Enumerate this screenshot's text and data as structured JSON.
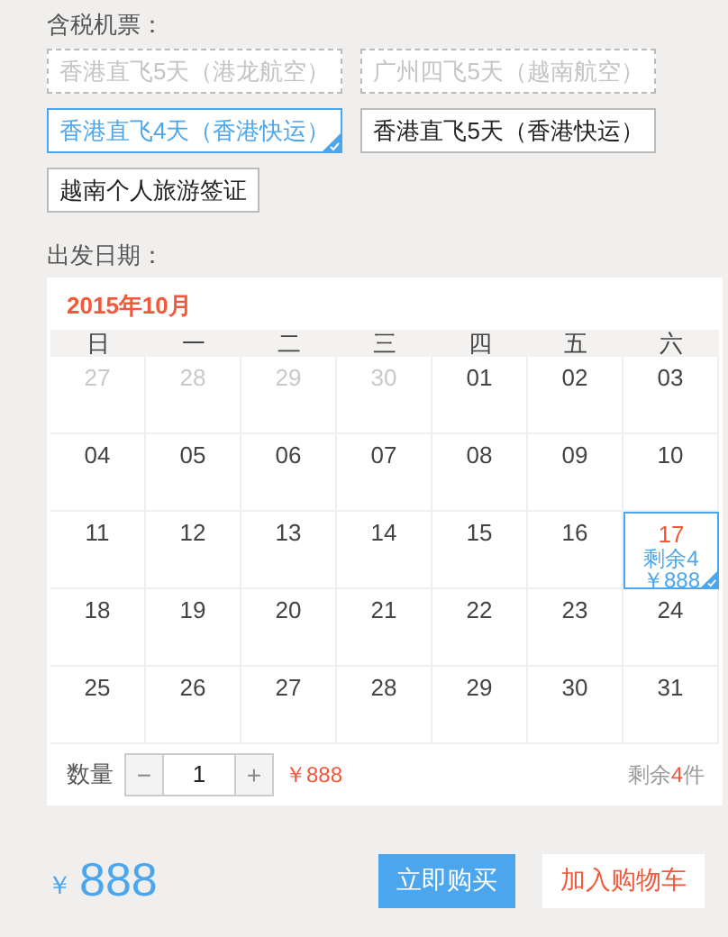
{
  "ticket_label": "含税机票：",
  "options": [
    {
      "label": "香港直飞5天（港龙航空）",
      "disabled": true,
      "selected": false
    },
    {
      "label": "广州四飞5天（越南航空）",
      "disabled": true,
      "selected": false
    },
    {
      "label": "香港直飞4天（香港快运）",
      "disabled": false,
      "selected": true
    },
    {
      "label": "香港直飞5天（香港快运）",
      "disabled": false,
      "selected": false
    },
    {
      "label": "越南个人旅游签证",
      "disabled": false,
      "selected": false
    }
  ],
  "date_label": "出发日期：",
  "calendar": {
    "month": "2015年10月",
    "weekdays": [
      "日",
      "一",
      "二",
      "三",
      "四",
      "五",
      "六"
    ],
    "days": [
      {
        "day": "27",
        "muted": true,
        "selected": false
      },
      {
        "day": "28",
        "muted": true,
        "selected": false
      },
      {
        "day": "29",
        "muted": true,
        "selected": false
      },
      {
        "day": "30",
        "muted": true,
        "selected": false
      },
      {
        "day": "01",
        "muted": false,
        "selected": false
      },
      {
        "day": "02",
        "muted": false,
        "selected": false
      },
      {
        "day": "03",
        "muted": false,
        "selected": false
      },
      {
        "day": "04",
        "muted": false,
        "selected": false
      },
      {
        "day": "05",
        "muted": false,
        "selected": false
      },
      {
        "day": "06",
        "muted": false,
        "selected": false
      },
      {
        "day": "07",
        "muted": false,
        "selected": false
      },
      {
        "day": "08",
        "muted": false,
        "selected": false
      },
      {
        "day": "09",
        "muted": false,
        "selected": false
      },
      {
        "day": "10",
        "muted": false,
        "selected": false
      },
      {
        "day": "11",
        "muted": false,
        "selected": false
      },
      {
        "day": "12",
        "muted": false,
        "selected": false
      },
      {
        "day": "13",
        "muted": false,
        "selected": false
      },
      {
        "day": "14",
        "muted": false,
        "selected": false
      },
      {
        "day": "15",
        "muted": false,
        "selected": false
      },
      {
        "day": "16",
        "muted": false,
        "selected": false
      },
      {
        "day": "17",
        "muted": false,
        "selected": true,
        "stock": "剩余4",
        "price": "￥888"
      },
      {
        "day": "18",
        "muted": false,
        "selected": false
      },
      {
        "day": "19",
        "muted": false,
        "selected": false
      },
      {
        "day": "20",
        "muted": false,
        "selected": false
      },
      {
        "day": "21",
        "muted": false,
        "selected": false
      },
      {
        "day": "22",
        "muted": false,
        "selected": false
      },
      {
        "day": "23",
        "muted": false,
        "selected": false
      },
      {
        "day": "24",
        "muted": false,
        "selected": false
      },
      {
        "day": "25",
        "muted": false,
        "selected": false
      },
      {
        "day": "26",
        "muted": false,
        "selected": false
      },
      {
        "day": "27",
        "muted": false,
        "selected": false
      },
      {
        "day": "28",
        "muted": false,
        "selected": false
      },
      {
        "day": "29",
        "muted": false,
        "selected": false
      },
      {
        "day": "30",
        "muted": false,
        "selected": false
      },
      {
        "day": "31",
        "muted": false,
        "selected": false
      }
    ]
  },
  "quantity": {
    "label": "数量",
    "minus": "−",
    "value": "1",
    "plus": "+",
    "unit_price": "￥888",
    "stock_prefix": "剩余",
    "stock_count": "4",
    "stock_suffix": "件"
  },
  "total": {
    "currency": "￥",
    "amount": "888"
  },
  "buttons": [
    {
      "label": "立即购买",
      "kind": "primary"
    },
    {
      "label": "加入购物车",
      "kind": "secondary"
    }
  ]
}
